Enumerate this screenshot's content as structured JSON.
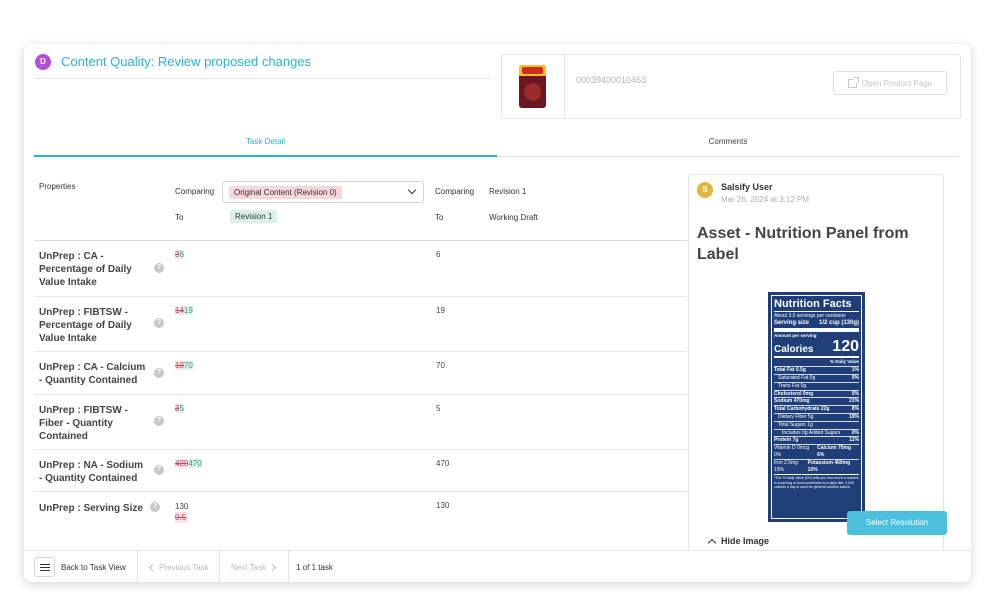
{
  "header": {
    "avatar_letter": "D",
    "title": "Content Quality: Review proposed changes",
    "product_id": "00039400010463",
    "open_product_label": "Open Product Page"
  },
  "tabs": [
    {
      "label": "Task Detail",
      "active": true
    },
    {
      "label": "Comments",
      "active": false
    }
  ],
  "compare": {
    "properties_label": "Properties",
    "comparing_label": "Comparing",
    "to_label": "To",
    "left_selected": "Original Content (Revision 0)",
    "left_to": "Revision 1",
    "right_comparing": "Revision 1",
    "right_to": "Working Draft"
  },
  "rows": [
    {
      "label": "UnPrep : CA - Percentage of Daily Value Intake",
      "old": "3",
      "new": "6",
      "current": "6"
    },
    {
      "label": "UnPrep : FIBTSW - Percentage of Daily Value Intake",
      "old": "14",
      "new": "19",
      "current": "19"
    },
    {
      "label": "UnPrep : CA - Calcium - Quantity Contained",
      "old": "10",
      "new": "70",
      "current": "70"
    },
    {
      "label": "UnPrep : FIBTSW - Fiber - Quantity Contained",
      "old": "3",
      "new": "5",
      "current": "5"
    },
    {
      "label": "UnPrep : NA - Sodium - Quantity Contained",
      "old": "420",
      "new": "470",
      "current": "470"
    },
    {
      "label": "UnPrep : Serving Size",
      "old": "0.5",
      "new": "130",
      "current": "130"
    }
  ],
  "comment": {
    "avatar_letter": "S",
    "user": "Salsify User",
    "time": "Mar 26, 2024 at 3:12 PM",
    "title": "Asset - Nutrition Panel from Label",
    "hide_image_label": "Hide Image"
  },
  "nutrition_label": {
    "title": "Nutrition Facts",
    "servings": "About 3.5 servings per container",
    "serving_size_label": "Serving size",
    "serving_size_value": "1/2 cup (130g)",
    "amount_per": "Amount per serving",
    "calories_label": "Calories",
    "calories_value": "120",
    "dv_header": "% Daily Value",
    "lines": [
      {
        "name": "Total Fat 0.5g",
        "dv": "1%",
        "bold": true,
        "indent": 0
      },
      {
        "name": "Saturated Fat 0g",
        "dv": "0%",
        "bold": false,
        "indent": 1
      },
      {
        "name": "Trans Fat 0g",
        "dv": "",
        "bold": false,
        "indent": 1
      },
      {
        "name": "Cholesterol 0mg",
        "dv": "0%",
        "bold": true,
        "indent": 0
      },
      {
        "name": "Sodium 470mg",
        "dv": "21%",
        "bold": true,
        "indent": 0
      },
      {
        "name": "Total Carbohydrate 22g",
        "dv": "8%",
        "bold": true,
        "indent": 0
      },
      {
        "name": "Dietary Fiber 5g",
        "dv": "19%",
        "bold": false,
        "indent": 1
      },
      {
        "name": "Total Sugars 1g",
        "dv": "",
        "bold": false,
        "indent": 1
      },
      {
        "name": "Includes 0g Added Sugars",
        "dv": "0%",
        "bold": false,
        "indent": 2
      },
      {
        "name": "Protein 7g",
        "dv": "11%",
        "bold": true,
        "indent": 0
      },
      {
        "name": "Vitamin D 0mcg 0%",
        "dv": "Calcium 70mg 6%",
        "bold": false,
        "indent": 0
      },
      {
        "name": "Iron 2.5mg 15%",
        "dv": "Potassium 460mg 10%",
        "bold": false,
        "indent": 0
      }
    ],
    "footnote": "*The % Daily Value (DV) tells you how much a nutrient in a serving of food contributes to a daily diet. 2,000 calories a day is used for general nutrition advice."
  },
  "footer": {
    "back_label": "Back to Task View",
    "prev_label": "Previous Task",
    "next_label": "Next Task",
    "count_label": "1 of 1 task",
    "resolve_label": "Select Resolution"
  },
  "colors": {
    "accent": "#2bb3d4",
    "button": "#4bc0de",
    "deleted": "#c0505d",
    "inserted": "#3a9a7a"
  }
}
